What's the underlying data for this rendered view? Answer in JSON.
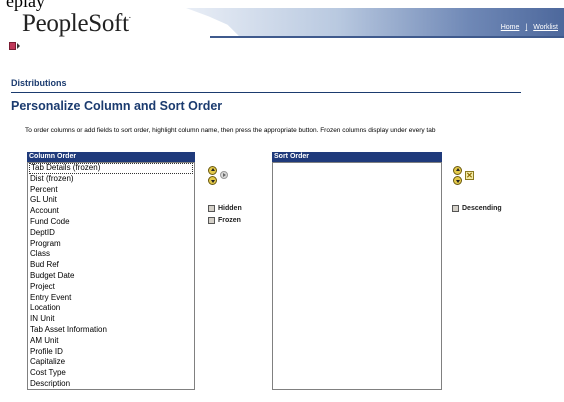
{
  "top_cutoff_text": "eplay",
  "header": {
    "logo_text": "PeopleSoft",
    "links": [
      "Home",
      "Worklist"
    ]
  },
  "section_title": "Distributions",
  "page_title": "Personalize Column and Sort Order",
  "instructions": "To order columns or add fields to sort order, highlight column name, then press the appropriate button.   Frozen columns display under every tab",
  "column_order": {
    "header": "Column Order",
    "items": [
      "Tab Details (frozen)",
      "Dist (frozen)",
      "Percent",
      "GL Unit",
      "Account",
      "Fund Code",
      "DeptID",
      "Program",
      "Class",
      "Bud Ref",
      "Budget Date",
      "Project",
      "Entry Event",
      "Location",
      "IN Unit",
      "Tab Asset Information",
      "AM Unit",
      "Profile ID",
      "Capitalize",
      "Cost Type",
      "Description"
    ],
    "selected_index": 0
  },
  "options": {
    "hidden_label": "Hidden",
    "frozen_label": "Frozen"
  },
  "sort_order": {
    "header": "Sort Order",
    "items": [],
    "descending_label": "Descending",
    "remove_symbol": "✕"
  },
  "colors": {
    "header_bg": "#1f3a7b",
    "title_color": "#1b3b6f"
  }
}
